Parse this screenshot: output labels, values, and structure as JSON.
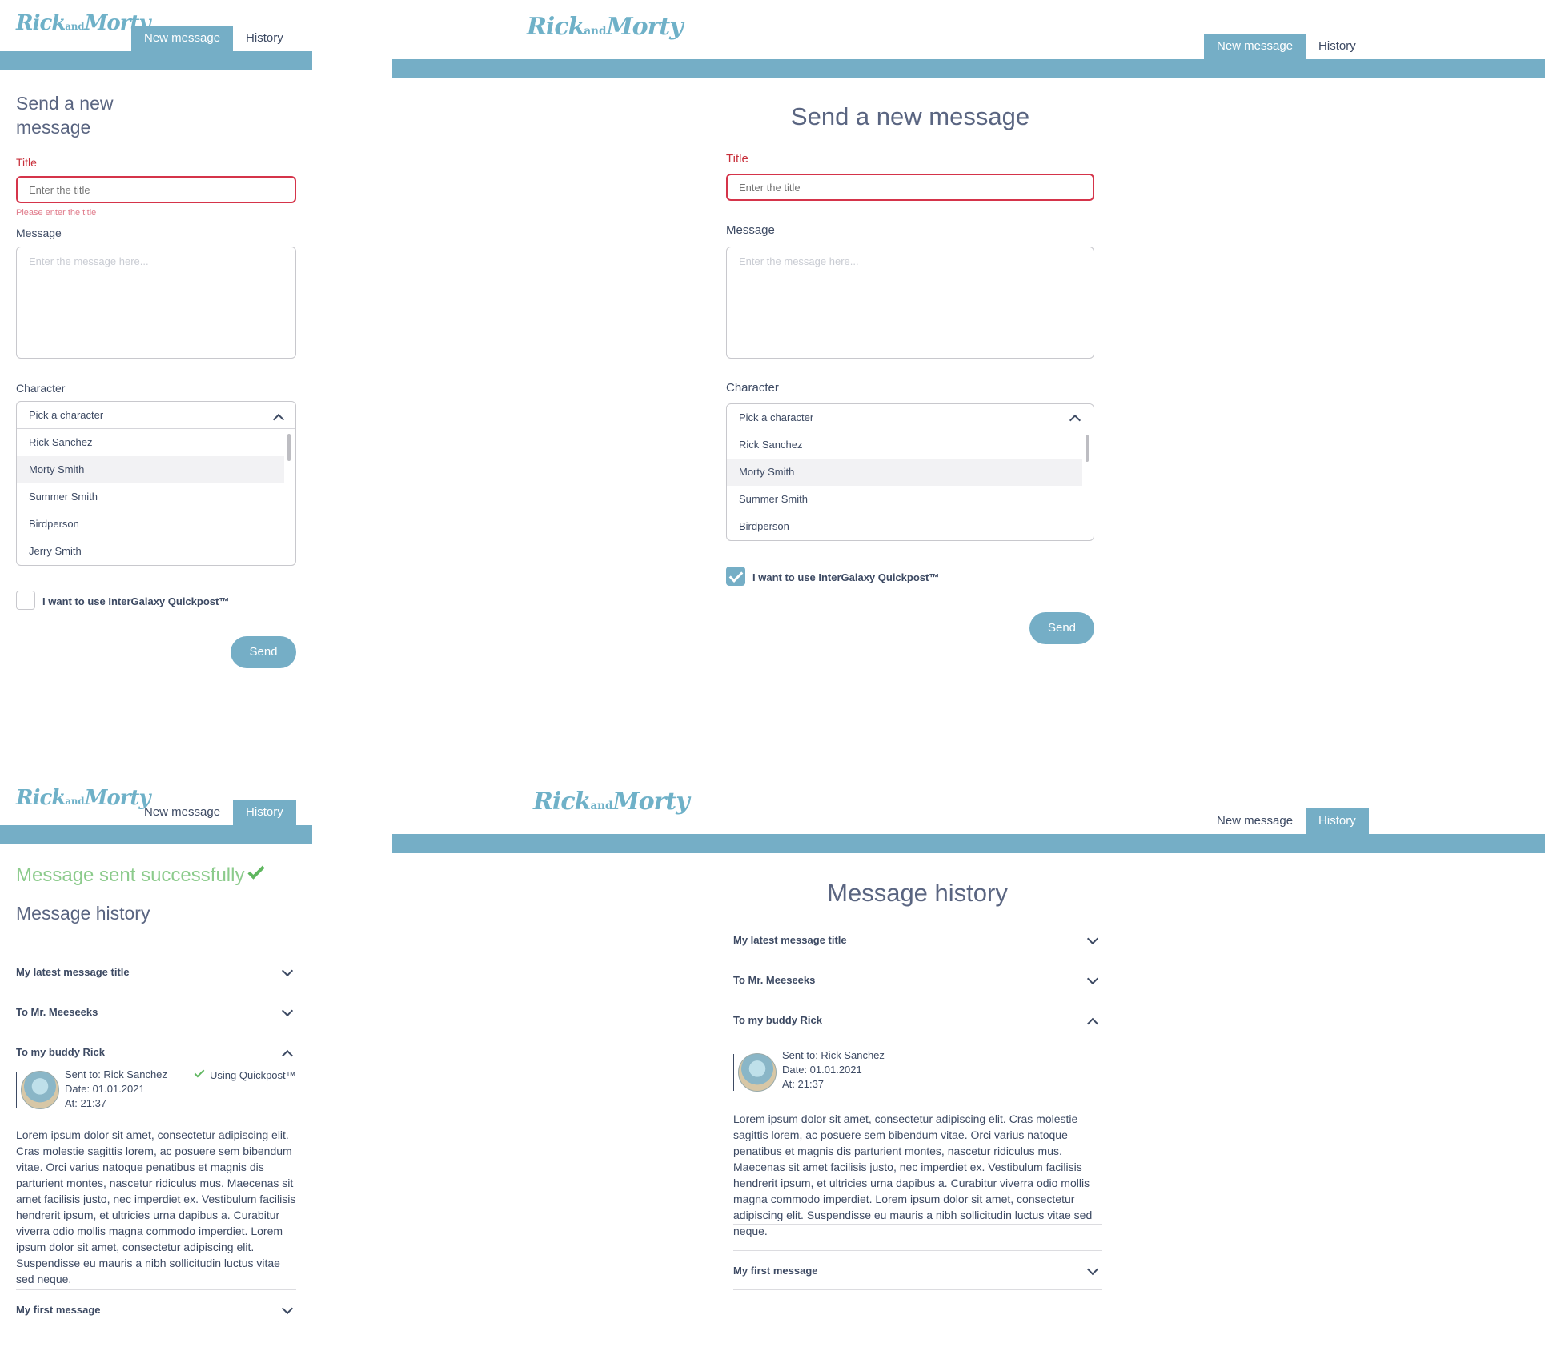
{
  "logo": {
    "part1": "Rick",
    "amp": "and",
    "part2": "Morty"
  },
  "nav": {
    "new_message": "New message",
    "history": "History"
  },
  "form": {
    "heading_mobile_line1": "Send a new",
    "heading_mobile_line2": "message",
    "heading": "Send a new message",
    "title_label": "Title",
    "title_placeholder": "Enter the title",
    "title_error": "Please enter the title",
    "message_label": "Message",
    "message_placeholder": "Enter the message here...",
    "character_label": "Character",
    "character_placeholder": "Pick a character",
    "characters": [
      "Rick Sanchez",
      "Morty Smith",
      "Summer Smith",
      "Birdperson",
      "Jerry Smith"
    ],
    "quickpost_label": "I want to use InterGalaxy Quickpost™",
    "send_label": "Send"
  },
  "history": {
    "success": "Message sent successfully",
    "heading": "Message history",
    "items": [
      {
        "title": "My latest message title"
      },
      {
        "title": "To Mr. Meeseeks"
      },
      {
        "title": "To my buddy Rick"
      },
      {
        "title": "My first message"
      }
    ],
    "expanded": {
      "sent_to": "Sent to: Rick Sanchez",
      "date": "Date: 01.01.2021",
      "at": "At: 21:37",
      "quickpost": "Using Quickpost™",
      "body": "Lorem ipsum dolor sit amet, consectetur adipiscing elit. Cras molestie sagittis lorem, ac posuere sem bibendum vitae. Orci varius natoque penatibus et magnis dis parturient montes, nascetur ridiculus mus. Maecenas sit amet facilisis justo, nec imperdiet ex. Vestibulum facilisis hendrerit ipsum, et ultricies urna dapibus a. Curabitur viverra odio mollis magna commodo imperdiet. Lorem ipsum dolor sit amet, consectetur adipiscing elit. Suspendisse eu mauris a nibh sollicitudin luctus vitae sed neque."
    }
  },
  "colors": {
    "accent": "#75aec6",
    "error": "#d5344a",
    "success": "#8ccb8c",
    "text": "#3d4a63"
  }
}
